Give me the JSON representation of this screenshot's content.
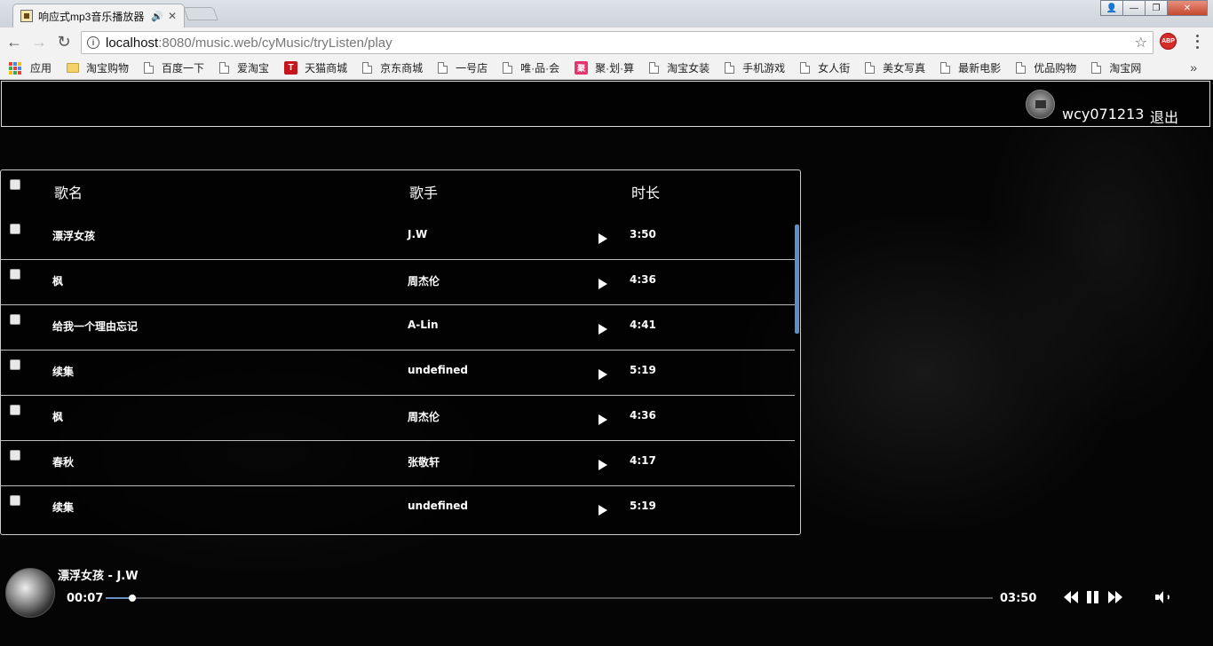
{
  "browser": {
    "tab_title": "响应式mp3音乐播放器",
    "url_host": "localhost",
    "url_rest": ":8080/music.web/cyMusic/tryListen/play",
    "bookmarks": [
      "应用",
      "淘宝购物",
      "百度一下",
      "爱淘宝",
      "天猫商城",
      "京东商城",
      "一号店",
      "唯·品·会",
      "聚·划·算",
      "淘宝女装",
      "手机游戏",
      "女人街",
      "美女写真",
      "最新电影",
      "优品购物",
      "淘宝网"
    ],
    "more_bookmarks": "»",
    "abp_label": "ABP"
  },
  "header": {
    "username": "wcy071213",
    "logout_label": "退出"
  },
  "song_list": {
    "columns": {
      "name": "歌名",
      "singer": "歌手",
      "duration": "时长"
    },
    "rows": [
      {
        "name": "漂浮女孩",
        "singer": "J.W",
        "duration": "3:50"
      },
      {
        "name": "枫",
        "singer": "周杰伦",
        "duration": "4:36"
      },
      {
        "name": "给我一个理由忘记",
        "singer": "A-Lin",
        "duration": "4:41"
      },
      {
        "name": "续集",
        "singer": "undefined",
        "duration": "5:19"
      },
      {
        "name": "枫",
        "singer": "周杰伦",
        "duration": "4:36"
      },
      {
        "name": "春秋",
        "singer": "张敬轩",
        "duration": "4:17"
      },
      {
        "name": "续集",
        "singer": "undefined",
        "duration": "5:19"
      }
    ]
  },
  "player": {
    "now_playing": "漂浮女孩 - J.W",
    "current_time": "00:07",
    "total_time": "03:50",
    "progress_fraction": 0.0304
  },
  "colors": {
    "page_bg": "#000000",
    "accent": "#5b8fc7"
  }
}
